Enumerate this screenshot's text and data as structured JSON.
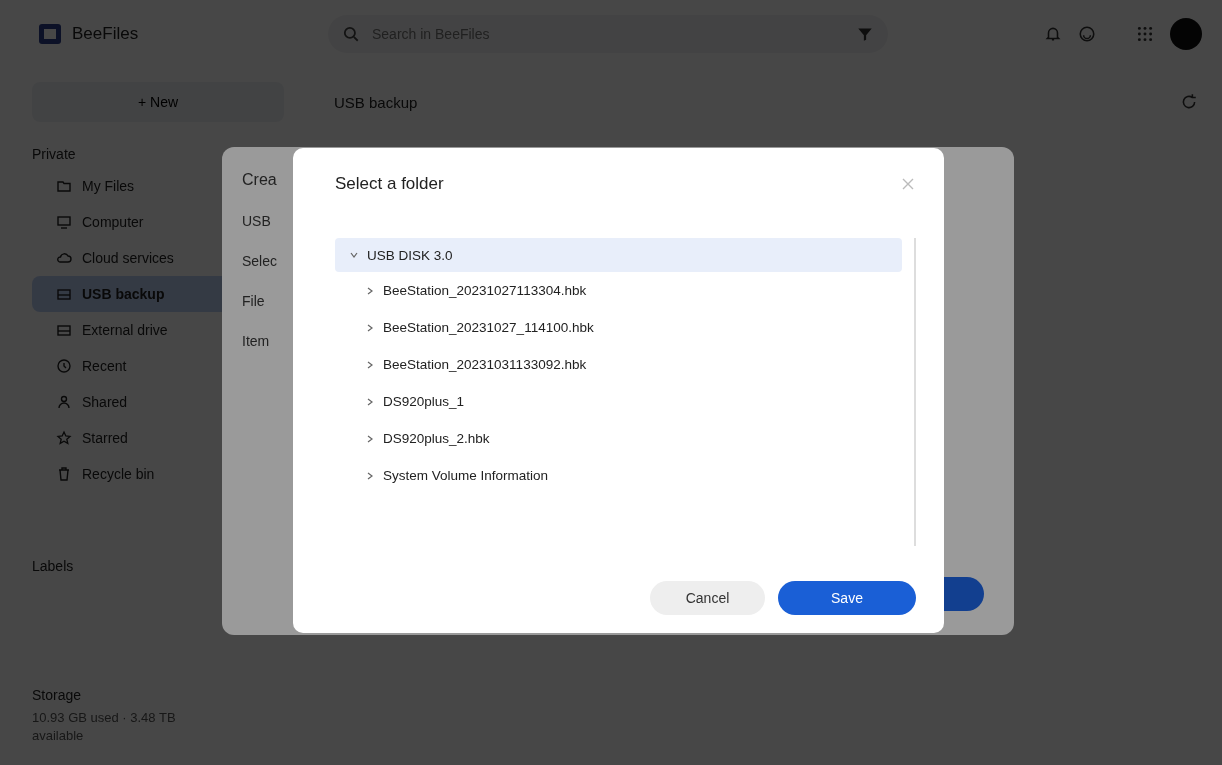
{
  "app": {
    "title": "BeeFiles",
    "search": {
      "placeholder": "Search in BeeFiles"
    }
  },
  "toolbar": {
    "new_button": "+ New",
    "breadcrumb": "USB backup"
  },
  "sidebar": {
    "section": "Private",
    "items": [
      {
        "label": "My Files",
        "selected": false
      },
      {
        "label": "Computer",
        "selected": false
      },
      {
        "label": "Cloud services",
        "selected": false
      },
      {
        "label": "USB backup",
        "selected": true
      },
      {
        "label": "External drive",
        "selected": false
      },
      {
        "label": "Recent",
        "selected": false
      },
      {
        "label": "Shared",
        "selected": false
      },
      {
        "label": "Starred",
        "selected": false
      },
      {
        "label": "Recycle bin",
        "selected": false
      }
    ],
    "labels_heading": "Labels",
    "storage": {
      "heading": "Storage",
      "usage": "10.93 GB used · 3.48 TB",
      "available": "available"
    }
  },
  "background_dialog": {
    "title": "Crea",
    "lines": [
      "USB",
      "Selec",
      "File",
      "Item"
    ]
  },
  "dialog": {
    "title": "Select a folder",
    "tree": [
      {
        "label": "USB DISK 3.0",
        "expanded": true,
        "selected": true,
        "children": [
          {
            "label": "BeeStation_20231027113304.hbk",
            "expanded": false,
            "selected": false
          },
          {
            "label": "BeeStation_20231027_114100.hbk",
            "expanded": false,
            "selected": false
          },
          {
            "label": "BeeStation_20231031133092.hbk",
            "expanded": false,
            "selected": false
          },
          {
            "label": "DS920plus_1",
            "expanded": false,
            "selected": false
          },
          {
            "label": "DS920plus_2.hbk",
            "expanded": false,
            "selected": false
          },
          {
            "label": "System Volume Information",
            "expanded": false,
            "selected": false
          }
        ]
      }
    ],
    "buttons": [
      {
        "label": "Cancel",
        "kind": "secondary"
      },
      {
        "label": "Save",
        "kind": "primary"
      }
    ]
  }
}
